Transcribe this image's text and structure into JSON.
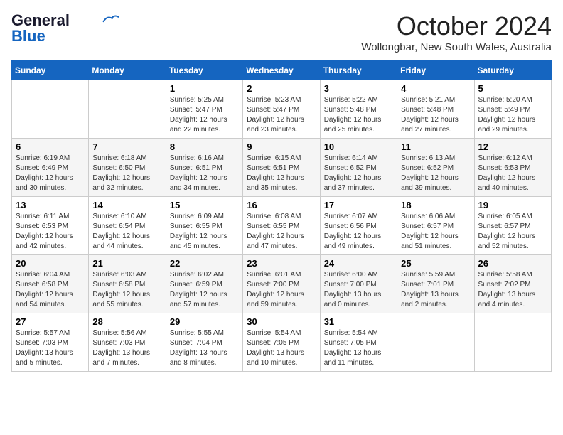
{
  "header": {
    "logo_line1": "General",
    "logo_line2": "Blue",
    "month_title": "October 2024",
    "location": "Wollongbar, New South Wales, Australia"
  },
  "days_of_week": [
    "Sunday",
    "Monday",
    "Tuesday",
    "Wednesday",
    "Thursday",
    "Friday",
    "Saturday"
  ],
  "weeks": [
    [
      {
        "day": "",
        "info": ""
      },
      {
        "day": "",
        "info": ""
      },
      {
        "day": "1",
        "sunrise": "Sunrise: 5:25 AM",
        "sunset": "Sunset: 5:47 PM",
        "daylight": "Daylight: 12 hours and 22 minutes."
      },
      {
        "day": "2",
        "sunrise": "Sunrise: 5:23 AM",
        "sunset": "Sunset: 5:47 PM",
        "daylight": "Daylight: 12 hours and 23 minutes."
      },
      {
        "day": "3",
        "sunrise": "Sunrise: 5:22 AM",
        "sunset": "Sunset: 5:48 PM",
        "daylight": "Daylight: 12 hours and 25 minutes."
      },
      {
        "day": "4",
        "sunrise": "Sunrise: 5:21 AM",
        "sunset": "Sunset: 5:48 PM",
        "daylight": "Daylight: 12 hours and 27 minutes."
      },
      {
        "day": "5",
        "sunrise": "Sunrise: 5:20 AM",
        "sunset": "Sunset: 5:49 PM",
        "daylight": "Daylight: 12 hours and 29 minutes."
      }
    ],
    [
      {
        "day": "6",
        "sunrise": "Sunrise: 6:19 AM",
        "sunset": "Sunset: 6:49 PM",
        "daylight": "Daylight: 12 hours and 30 minutes."
      },
      {
        "day": "7",
        "sunrise": "Sunrise: 6:18 AM",
        "sunset": "Sunset: 6:50 PM",
        "daylight": "Daylight: 12 hours and 32 minutes."
      },
      {
        "day": "8",
        "sunrise": "Sunrise: 6:16 AM",
        "sunset": "Sunset: 6:51 PM",
        "daylight": "Daylight: 12 hours and 34 minutes."
      },
      {
        "day": "9",
        "sunrise": "Sunrise: 6:15 AM",
        "sunset": "Sunset: 6:51 PM",
        "daylight": "Daylight: 12 hours and 35 minutes."
      },
      {
        "day": "10",
        "sunrise": "Sunrise: 6:14 AM",
        "sunset": "Sunset: 6:52 PM",
        "daylight": "Daylight: 12 hours and 37 minutes."
      },
      {
        "day": "11",
        "sunrise": "Sunrise: 6:13 AM",
        "sunset": "Sunset: 6:52 PM",
        "daylight": "Daylight: 12 hours and 39 minutes."
      },
      {
        "day": "12",
        "sunrise": "Sunrise: 6:12 AM",
        "sunset": "Sunset: 6:53 PM",
        "daylight": "Daylight: 12 hours and 40 minutes."
      }
    ],
    [
      {
        "day": "13",
        "sunrise": "Sunrise: 6:11 AM",
        "sunset": "Sunset: 6:53 PM",
        "daylight": "Daylight: 12 hours and 42 minutes."
      },
      {
        "day": "14",
        "sunrise": "Sunrise: 6:10 AM",
        "sunset": "Sunset: 6:54 PM",
        "daylight": "Daylight: 12 hours and 44 minutes."
      },
      {
        "day": "15",
        "sunrise": "Sunrise: 6:09 AM",
        "sunset": "Sunset: 6:55 PM",
        "daylight": "Daylight: 12 hours and 45 minutes."
      },
      {
        "day": "16",
        "sunrise": "Sunrise: 6:08 AM",
        "sunset": "Sunset: 6:55 PM",
        "daylight": "Daylight: 12 hours and 47 minutes."
      },
      {
        "day": "17",
        "sunrise": "Sunrise: 6:07 AM",
        "sunset": "Sunset: 6:56 PM",
        "daylight": "Daylight: 12 hours and 49 minutes."
      },
      {
        "day": "18",
        "sunrise": "Sunrise: 6:06 AM",
        "sunset": "Sunset: 6:57 PM",
        "daylight": "Daylight: 12 hours and 51 minutes."
      },
      {
        "day": "19",
        "sunrise": "Sunrise: 6:05 AM",
        "sunset": "Sunset: 6:57 PM",
        "daylight": "Daylight: 12 hours and 52 minutes."
      }
    ],
    [
      {
        "day": "20",
        "sunrise": "Sunrise: 6:04 AM",
        "sunset": "Sunset: 6:58 PM",
        "daylight": "Daylight: 12 hours and 54 minutes."
      },
      {
        "day": "21",
        "sunrise": "Sunrise: 6:03 AM",
        "sunset": "Sunset: 6:58 PM",
        "daylight": "Daylight: 12 hours and 55 minutes."
      },
      {
        "day": "22",
        "sunrise": "Sunrise: 6:02 AM",
        "sunset": "Sunset: 6:59 PM",
        "daylight": "Daylight: 12 hours and 57 minutes."
      },
      {
        "day": "23",
        "sunrise": "Sunrise: 6:01 AM",
        "sunset": "Sunset: 7:00 PM",
        "daylight": "Daylight: 12 hours and 59 minutes."
      },
      {
        "day": "24",
        "sunrise": "Sunrise: 6:00 AM",
        "sunset": "Sunset: 7:00 PM",
        "daylight": "Daylight: 13 hours and 0 minutes."
      },
      {
        "day": "25",
        "sunrise": "Sunrise: 5:59 AM",
        "sunset": "Sunset: 7:01 PM",
        "daylight": "Daylight: 13 hours and 2 minutes."
      },
      {
        "day": "26",
        "sunrise": "Sunrise: 5:58 AM",
        "sunset": "Sunset: 7:02 PM",
        "daylight": "Daylight: 13 hours and 4 minutes."
      }
    ],
    [
      {
        "day": "27",
        "sunrise": "Sunrise: 5:57 AM",
        "sunset": "Sunset: 7:03 PM",
        "daylight": "Daylight: 13 hours and 5 minutes."
      },
      {
        "day": "28",
        "sunrise": "Sunrise: 5:56 AM",
        "sunset": "Sunset: 7:03 PM",
        "daylight": "Daylight: 13 hours and 7 minutes."
      },
      {
        "day": "29",
        "sunrise": "Sunrise: 5:55 AM",
        "sunset": "Sunset: 7:04 PM",
        "daylight": "Daylight: 13 hours and 8 minutes."
      },
      {
        "day": "30",
        "sunrise": "Sunrise: 5:54 AM",
        "sunset": "Sunset: 7:05 PM",
        "daylight": "Daylight: 13 hours and 10 minutes."
      },
      {
        "day": "31",
        "sunrise": "Sunrise: 5:54 AM",
        "sunset": "Sunset: 7:05 PM",
        "daylight": "Daylight: 13 hours and 11 minutes."
      },
      {
        "day": "",
        "info": ""
      },
      {
        "day": "",
        "info": ""
      }
    ]
  ]
}
